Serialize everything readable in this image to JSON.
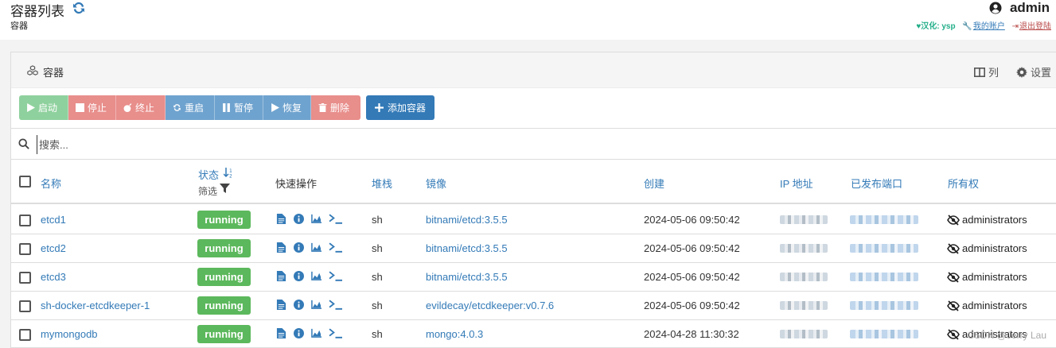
{
  "header": {
    "title": "容器列表",
    "subtitle": "容器",
    "username": "admin",
    "links": {
      "translate": "♥汉化: ysp",
      "account": "我的账户",
      "logout": "退出登陆"
    }
  },
  "panel": {
    "heading": "容器",
    "columns_label": "列",
    "settings_label": "设置"
  },
  "toolbar": {
    "start": "启动",
    "stop": "停止",
    "kill": "终止",
    "restart": "重启",
    "pause": "暂停",
    "resume": "恢复",
    "remove": "删除",
    "add": "添加容器"
  },
  "search": {
    "placeholder": "搜索..."
  },
  "table": {
    "headers": {
      "name": "名称",
      "state": "状态",
      "filter": "筛选",
      "quick": "快速操作",
      "stack": "堆栈",
      "image": "镜像",
      "created": "创建",
      "ip": "IP 地址",
      "ports": "已发布端口",
      "ownership": "所有权"
    },
    "rows": [
      {
        "name": "etcd1",
        "state": "running",
        "stack": "sh",
        "image": "bitnami/etcd:3.5.5",
        "created": "2024-05-06 09:50:42",
        "ownership": "administrators"
      },
      {
        "name": "etcd2",
        "state": "running",
        "stack": "sh",
        "image": "bitnami/etcd:3.5.5",
        "created": "2024-05-06 09:50:42",
        "ownership": "administrators"
      },
      {
        "name": "etcd3",
        "state": "running",
        "stack": "sh",
        "image": "bitnami/etcd:3.5.5",
        "created": "2024-05-06 09:50:42",
        "ownership": "administrators"
      },
      {
        "name": "sh-docker-etcdkeeper-1",
        "state": "running",
        "stack": "sh",
        "image": "evildecay/etcdkeeper:v0.7.6",
        "created": "2024-05-06 09:50:42",
        "ownership": "administrators"
      },
      {
        "name": "mymongodb",
        "state": "running",
        "stack": "sh",
        "image": "mongo:4.0.3",
        "created": "2024-04-28 11:30:32",
        "ownership": "administrators"
      }
    ]
  },
  "watermark": "CSDN @Jerry Lau",
  "colors": {
    "primary": "#337ab7",
    "success": "#5cb85c",
    "danger": "#e88e8b",
    "info": "#6fa3cf",
    "start": "#8fd19e"
  }
}
